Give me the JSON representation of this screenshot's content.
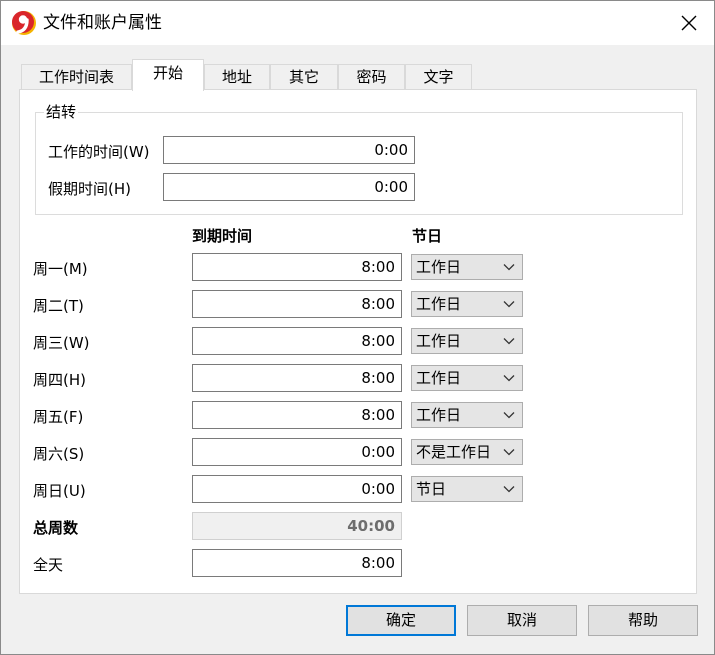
{
  "window": {
    "title": "文件和账户属性"
  },
  "tabs": [
    {
      "label": "工作时间表",
      "active": false
    },
    {
      "label": "开始",
      "active": true
    },
    {
      "label": "地址",
      "active": false
    },
    {
      "label": "其它",
      "active": false
    },
    {
      "label": "密码",
      "active": false
    },
    {
      "label": "文字",
      "active": false
    }
  ],
  "carryover": {
    "group_title": "结转",
    "work_time_label": "工作的时间(W)",
    "work_time_value": "0:00",
    "holiday_time_label": "假期时间(H)",
    "holiday_time_value": "0:00"
  },
  "schedule": {
    "due_time_header": "到期时间",
    "holiday_header": "节日",
    "days": [
      {
        "label": "周一(M)",
        "time": "8:00",
        "type": "工作日"
      },
      {
        "label": "周二(T)",
        "time": "8:00",
        "type": "工作日"
      },
      {
        "label": "周三(W)",
        "time": "8:00",
        "type": "工作日"
      },
      {
        "label": "周四(H)",
        "time": "8:00",
        "type": "工作日"
      },
      {
        "label": "周五(F)",
        "time": "8:00",
        "type": "工作日"
      },
      {
        "label": "周六(S)",
        "time": "0:00",
        "type": "不是工作日"
      },
      {
        "label": "周日(U)",
        "time": "0:00",
        "type": "节日"
      }
    ],
    "total_label": "总周数",
    "total_value": "40:00",
    "full_day_label": "全天",
    "full_day_value": "8:00"
  },
  "buttons": {
    "ok": "确定",
    "cancel": "取消",
    "help": "帮助"
  },
  "colors": {
    "accent": "#0078d7",
    "app_icon_red": "#d9262b",
    "app_icon_yellow": "#f5b400"
  }
}
